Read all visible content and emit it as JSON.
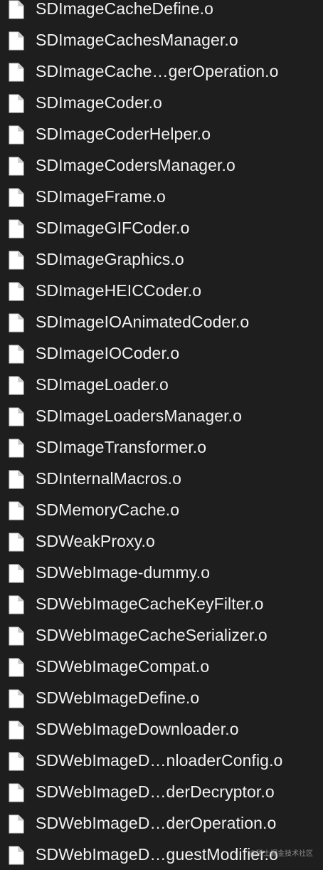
{
  "files": [
    {
      "name": "SDImageCacheDefine.o",
      "icon": "document-icon"
    },
    {
      "name": "SDImageCachesManager.o",
      "icon": "document-icon"
    },
    {
      "name": "SDImageCache…gerOperation.o",
      "icon": "document-icon"
    },
    {
      "name": "SDImageCoder.o",
      "icon": "document-icon"
    },
    {
      "name": "SDImageCoderHelper.o",
      "icon": "document-icon"
    },
    {
      "name": "SDImageCodersManager.o",
      "icon": "document-icon"
    },
    {
      "name": "SDImageFrame.o",
      "icon": "document-icon"
    },
    {
      "name": "SDImageGIFCoder.o",
      "icon": "document-icon"
    },
    {
      "name": "SDImageGraphics.o",
      "icon": "document-icon"
    },
    {
      "name": "SDImageHEICCoder.o",
      "icon": "document-icon"
    },
    {
      "name": "SDImageIOAnimatedCoder.o",
      "icon": "document-icon"
    },
    {
      "name": "SDImageIOCoder.o",
      "icon": "document-icon"
    },
    {
      "name": "SDImageLoader.o",
      "icon": "document-icon"
    },
    {
      "name": "SDImageLoadersManager.o",
      "icon": "document-icon"
    },
    {
      "name": "SDImageTransformer.o",
      "icon": "document-icon"
    },
    {
      "name": "SDInternalMacros.o",
      "icon": "document-icon"
    },
    {
      "name": "SDMemoryCache.o",
      "icon": "document-icon"
    },
    {
      "name": "SDWeakProxy.o",
      "icon": "document-icon"
    },
    {
      "name": "SDWebImage-dummy.o",
      "icon": "document-icon"
    },
    {
      "name": "SDWebImageCacheKeyFilter.o",
      "icon": "document-icon"
    },
    {
      "name": "SDWebImageCacheSerializer.o",
      "icon": "document-icon"
    },
    {
      "name": "SDWebImageCompat.o",
      "icon": "document-icon"
    },
    {
      "name": "SDWebImageDefine.o",
      "icon": "document-icon"
    },
    {
      "name": "SDWebImageDownloader.o",
      "icon": "document-icon"
    },
    {
      "name": "SDWebImageD…nloaderConfig.o",
      "icon": "document-icon"
    },
    {
      "name": "SDWebImageD…derDecryptor.o",
      "icon": "document-icon"
    },
    {
      "name": "SDWebImageD…derOperation.o",
      "icon": "document-icon"
    },
    {
      "name": "SDWebImageD…guestModifier.o",
      "icon": "document-icon"
    }
  ],
  "watermark": "@稀土掘金技术社区",
  "colors": {
    "background": "#1e1e1e",
    "text": "#f2f2f2",
    "icon": "#ffffff"
  }
}
